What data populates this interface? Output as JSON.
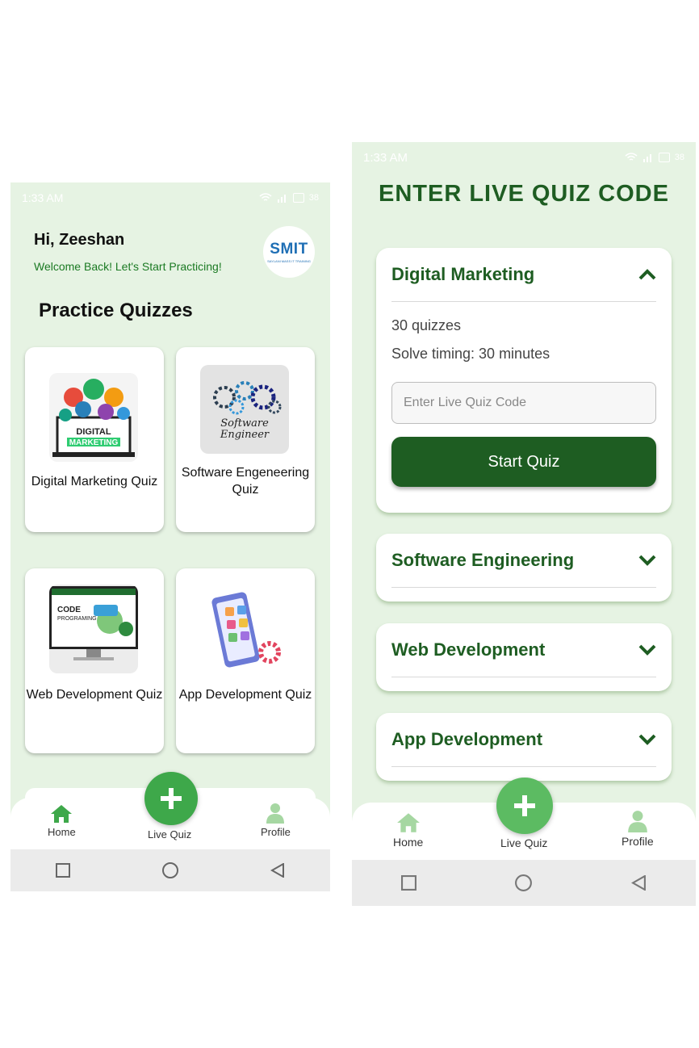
{
  "screen_home": {
    "status": {
      "time": "1:33 AM",
      "battery": "38"
    },
    "greeting": "Hi, Zeeshan",
    "welcome": "Welcome Back! Let's Start Practicing!",
    "logo": {
      "text_main": "SMIT",
      "text_sub": "SAYLANI MASS IT TRAINING"
    },
    "section_title": "Practice Quizzes",
    "quizzes": [
      {
        "label": "Digital Marketing Quiz",
        "thumb_text": "DIGITAL MARKETING"
      },
      {
        "label": "Software Engeneering Quiz",
        "thumb_text": "Software Engineer"
      },
      {
        "label": "Web Development Quiz",
        "thumb_text": "CODE PROGRAMING"
      },
      {
        "label": "App Development Quiz",
        "thumb_text": ""
      }
    ],
    "nav": {
      "home": "Home",
      "live_quiz": "Live Quiz",
      "profile": "Profile"
    }
  },
  "screen_live": {
    "status": {
      "time": "1:33 AM",
      "battery": "38"
    },
    "title": "ENTER LIVE QUIZ CODE",
    "sections": [
      {
        "name": "Digital Marketing",
        "expanded": true,
        "quizzes": "30 quizzes",
        "timing": "Solve timing: 30 minutes"
      },
      {
        "name": "Software Engineering",
        "expanded": false
      },
      {
        "name": "Web Development",
        "expanded": false
      },
      {
        "name": "App Development",
        "expanded": false
      }
    ],
    "code_placeholder": "Enter Live Quiz Code",
    "start_label": "Start Quiz",
    "nav": {
      "home": "Home",
      "live_quiz": "Live Quiz",
      "profile": "Profile"
    }
  },
  "colors": {
    "accent": "#3ea84a",
    "dark_green": "#1e5d22",
    "background": "#e6f3e3"
  }
}
